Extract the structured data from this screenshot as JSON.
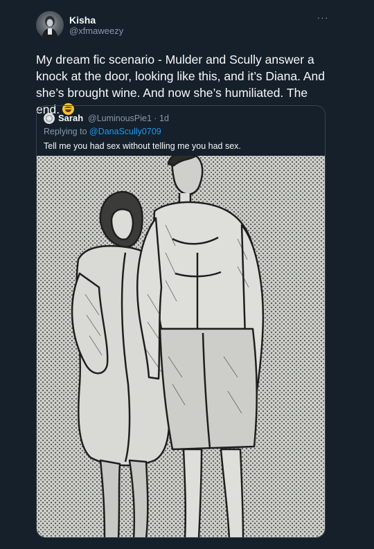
{
  "author": {
    "display_name": "Kisha",
    "handle": "@xfmaweezy",
    "avatar_icon": "profile-photo-icon"
  },
  "more_icon": "ellipsis-icon",
  "tweet": {
    "text": "My dream fic scenario - Mulder and Scully answer a knock at the door, looking like this, and it’s Diana. And she’s brought wine. And now she’s humiliated. The end.",
    "emoji": "grinning-squinting-face-icon"
  },
  "quoted_tweet": {
    "display_name": "Sarah",
    "meta": "@LuminousPie1 · 1d",
    "replying_prefix": "Replying to ",
    "replying_to": "@DanaScully0709",
    "text": "Tell me you had sex without telling me you had sex.",
    "media_icon": "sketch-illustration-image"
  },
  "colors": {
    "background": "#15202b",
    "text": "#f7f9f9",
    "secondary": "#8b98a5",
    "accent": "#1d9bf0",
    "border": "#38444d"
  }
}
